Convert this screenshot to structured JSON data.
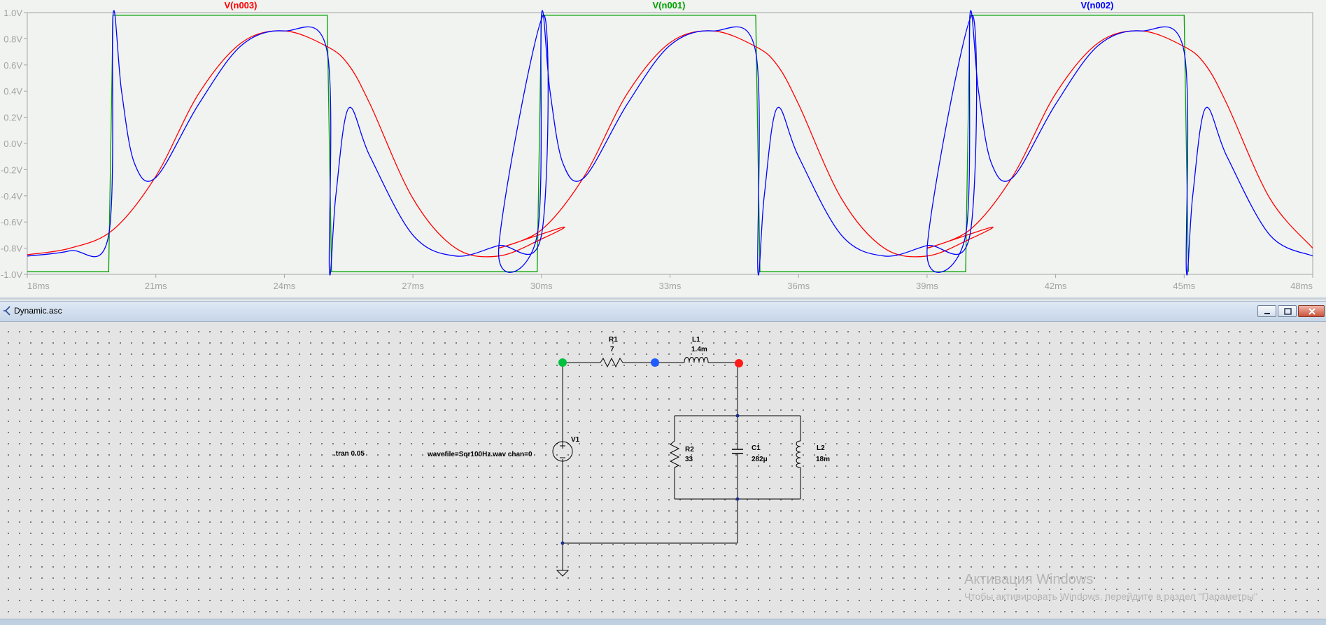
{
  "chart_data": {
    "type": "line",
    "x_unit": "ms",
    "xlim": [
      18,
      48
    ],
    "ylim": [
      -1.0,
      1.0
    ],
    "x_ticks": [
      "18ms",
      "21ms",
      "24ms",
      "27ms",
      "30ms",
      "33ms",
      "36ms",
      "39ms",
      "42ms",
      "45ms",
      "48ms"
    ],
    "y_ticks": [
      "1.0V",
      "0.8V",
      "0.6V",
      "0.4V",
      "0.2V",
      "0.0V",
      "-0.2V",
      "-0.4V",
      "-0.6V",
      "-0.8V",
      "-1.0V"
    ],
    "grid": false,
    "legend_placement": "top",
    "series": [
      {
        "name": "V(n003)",
        "color": "#ff0000",
        "x": [
          18,
          19,
          20,
          21,
          22,
          23,
          24,
          25,
          25.5,
          26,
          27,
          28,
          29,
          30,
          30.5
        ],
        "values": [
          -0.85,
          -0.8,
          -0.66,
          -0.25,
          0.38,
          0.77,
          0.86,
          0.74,
          0.6,
          0.3,
          -0.42,
          -0.8,
          -0.86,
          -0.73,
          -0.64
        ]
      },
      {
        "name": "V(n001)",
        "color": "#00a000",
        "x": [
          18,
          19.9,
          20.0,
          25.0,
          25.1,
          29.9,
          30.0
        ],
        "values": [
          -0.98,
          -0.98,
          0.98,
          0.98,
          -0.98,
          -0.98,
          0.98
        ]
      },
      {
        "name": "V(n002)",
        "color": "#0000ff",
        "x": [
          18,
          19,
          19.9,
          20.0,
          20.2,
          20.5,
          21,
          22,
          23,
          24,
          25,
          25.05,
          25.2,
          25.5,
          26,
          27,
          28,
          29,
          30,
          30.05
        ],
        "values": [
          -0.86,
          -0.82,
          -0.7,
          0.98,
          0.4,
          -0.15,
          -0.26,
          0.3,
          0.75,
          0.86,
          0.7,
          -0.97,
          -0.4,
          0.27,
          -0.1,
          -0.7,
          -0.86,
          -0.78,
          -0.7,
          0.98
        ]
      }
    ]
  },
  "window": {
    "title": "Dynamic.asc",
    "minimize_label": "minimize",
    "maximize_label": "maximize",
    "close_label": "close"
  },
  "schematic": {
    "components": [
      {
        "ref": "R1",
        "value": "7"
      },
      {
        "ref": "L1",
        "value": "1.4m"
      },
      {
        "ref": "V1",
        "value": ""
      },
      {
        "ref": "R2",
        "value": "33"
      },
      {
        "ref": "C1",
        "value": "282μ"
      },
      {
        "ref": "L2",
        "value": "18m"
      }
    ],
    "directives": {
      "tran": ".tran 0.05",
      "wavefile": "wavefile=Sqr100Hz.wav chan=0"
    },
    "node_colors": {
      "n001": "#00c040",
      "n002": "#1e5cff",
      "n003": "#ff1a1a"
    }
  },
  "watermark": {
    "title": "Активация Windows",
    "subtitle": "Чтобы активировать Windows, перейдите в раздел \"Параметры\""
  }
}
